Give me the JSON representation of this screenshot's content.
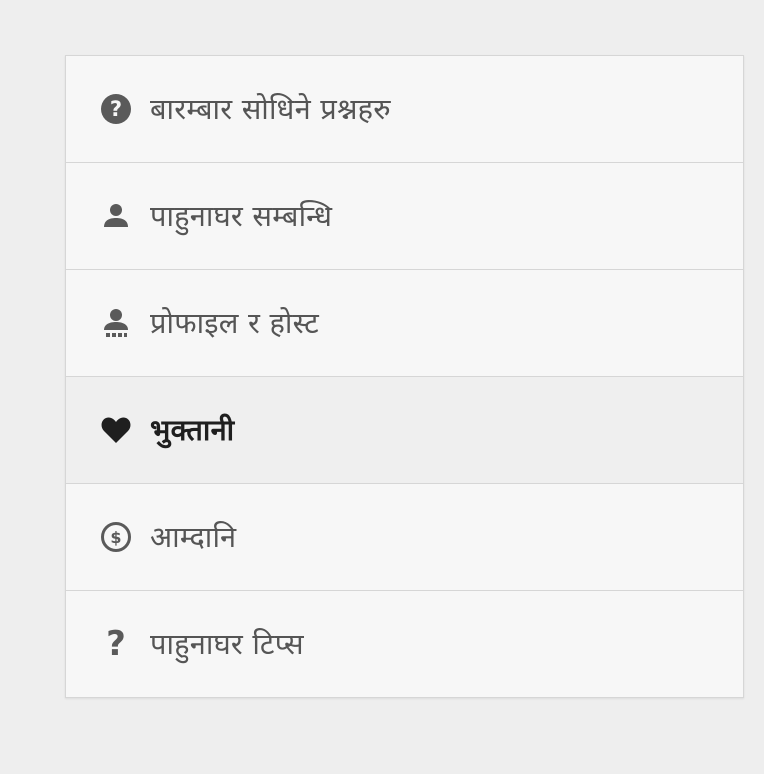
{
  "menu": {
    "items": [
      {
        "label": "बारम्बार सोधिने प्रश्नहरु",
        "icon": "help-circle-icon",
        "active": false
      },
      {
        "label": "पाहुनाघर सम्बन्धि",
        "icon": "person-icon",
        "active": false
      },
      {
        "label": "प्रोफाइल र होस्ट",
        "icon": "person-dots-icon",
        "active": false
      },
      {
        "label": "भुक्तानी",
        "icon": "heart-icon",
        "active": true
      },
      {
        "label": "आम्दानि",
        "icon": "dollar-circle-icon",
        "active": false
      },
      {
        "label": "पाहुनाघर टिप्स",
        "icon": "question-mark-icon",
        "active": false
      }
    ]
  },
  "colors": {
    "background": "#eeeeee",
    "card": "#f7f7f7",
    "active_row": "#efefef",
    "icon": "#5a5a5a",
    "text": "#555555",
    "active_text": "#1f1f1f",
    "active_icon": "#1f1f1f"
  }
}
